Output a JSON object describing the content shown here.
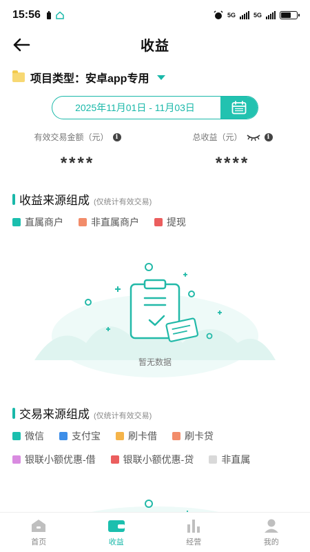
{
  "status_bar": {
    "time": "15:56",
    "net1": "5G",
    "net2": "5G"
  },
  "header": {
    "title": "收益"
  },
  "project": {
    "label": "项目类型：安卓app专用"
  },
  "date_range": {
    "text": "2025年11月01日 - 11月03日"
  },
  "metrics": {
    "valid_amount_label": "有效交易金额（元）",
    "valid_amount_value": "****",
    "total_income_label": "总收益（元）",
    "total_income_value": "****"
  },
  "income_source": {
    "title": "收益来源组成",
    "subtitle": "(仅统计有效交易)",
    "legend": [
      {
        "label": "直属商户",
        "color": "#1bbfae"
      },
      {
        "label": "非直属商户",
        "color": "#f28c6a"
      },
      {
        "label": "提现",
        "color": "#eb5e5e"
      }
    ],
    "empty_text": "暂无数据"
  },
  "trade_source": {
    "title": "交易来源组成",
    "subtitle": "(仅统计有效交易)",
    "legend": [
      {
        "label": "微信",
        "color": "#1bbfae"
      },
      {
        "label": "支付宝",
        "color": "#3d8ee8"
      },
      {
        "label": "刷卡借",
        "color": "#f5b44a"
      },
      {
        "label": "刷卡贷",
        "color": "#f28c6a"
      },
      {
        "label": "银联小额优惠-借",
        "color": "#d98be0"
      },
      {
        "label": "银联小额优惠-贷",
        "color": "#eb5e5e"
      },
      {
        "label": "非直属",
        "color": "#d9d9d9"
      }
    ]
  },
  "bottom_nav": [
    {
      "label": "首页",
      "icon": "home-icon",
      "active": false
    },
    {
      "label": "收益",
      "icon": "wallet-icon",
      "active": true
    },
    {
      "label": "经营",
      "icon": "bar-chart-icon",
      "active": false
    },
    {
      "label": "我的",
      "icon": "user-icon",
      "active": false
    }
  ],
  "colors": {
    "accent": "#19b8a9"
  }
}
